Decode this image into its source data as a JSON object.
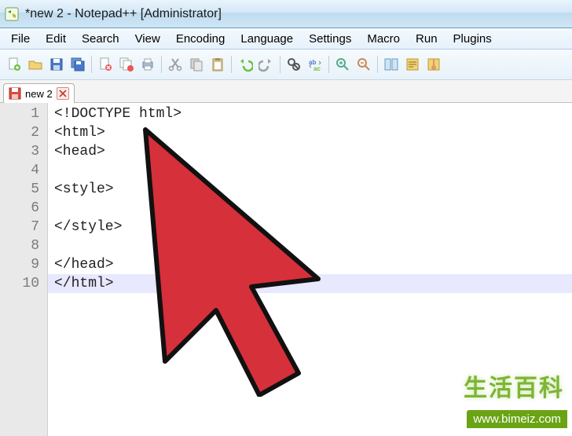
{
  "title": "*new 2 - Notepad++ [Administrator]",
  "menu": [
    "File",
    "Edit",
    "Search",
    "View",
    "Encoding",
    "Language",
    "Settings",
    "Macro",
    "Run",
    "Plugins"
  ],
  "tab": {
    "label": "new 2"
  },
  "code": {
    "lines": [
      "<!DOCTYPE html>",
      "<html>",
      "<head>",
      "",
      "<style>",
      "",
      "</style>",
      "",
      "</head>",
      "</html>"
    ],
    "current_line": 10
  },
  "watermark": {
    "cn": "生活百科",
    "url": "www.bimeiz.com"
  }
}
